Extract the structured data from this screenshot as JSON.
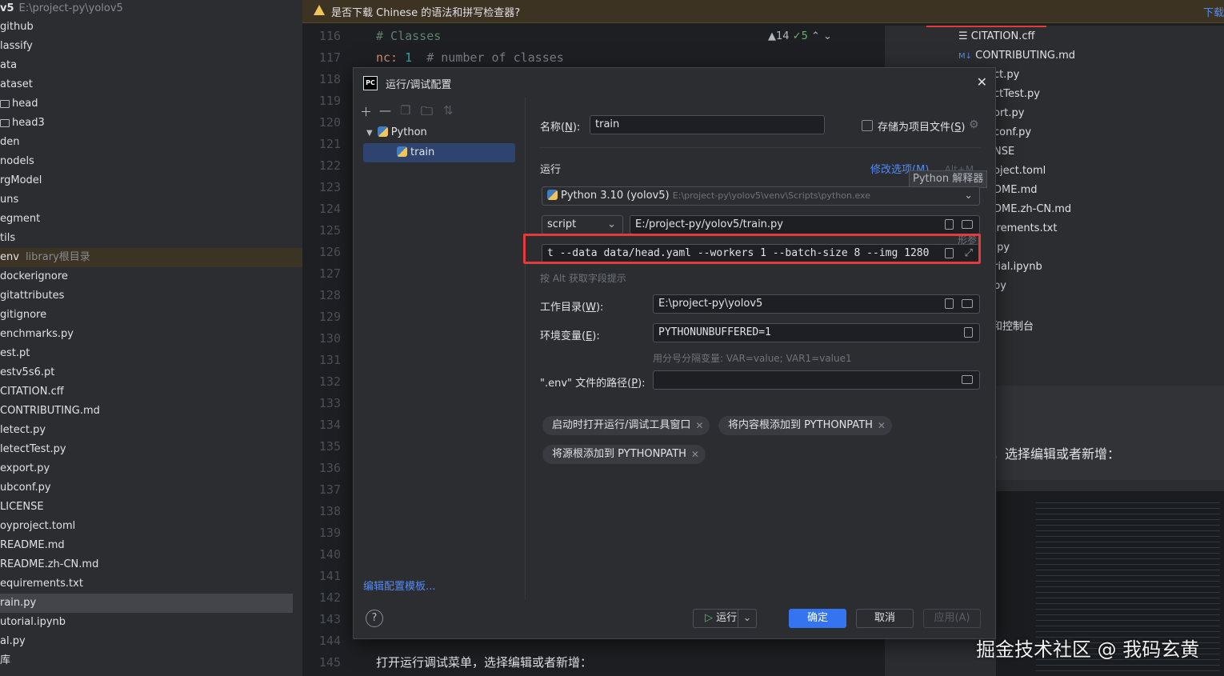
{
  "tree": {
    "header_name": "v5",
    "header_path": "E:\\project-py\\yolov5",
    "items": [
      "github",
      "lassify",
      "ata",
      "ataset",
      "head",
      "head3",
      "den",
      "nodels",
      "rgModel",
      "uns",
      "egment",
      "tils",
      "env",
      "dockerignore",
      "gitattributes",
      "gitignore",
      "enchmarks.py",
      "est.pt",
      "estv5s6.pt",
      "CITATION.cff",
      "CONTRIBUTING.md",
      "letect.py",
      "letectTest.py",
      "export.py",
      "ubconf.py",
      "LICENSE",
      "oyproject.toml",
      "README.md",
      "README.zh-CN.md",
      "equirements.txt",
      "rain.py",
      "utorial.ipynb",
      "al.py",
      "库"
    ],
    "venv_lib": "library根目录"
  },
  "notification": {
    "text": "是否下载 Chinese 的语法和拼写检查器?",
    "download": "下载"
  },
  "gutter": {
    "lines": [
      "116",
      "117",
      "118",
      "119",
      "120",
      "121",
      "122",
      "123",
      "124",
      "125",
      "126",
      "127",
      "128",
      "129",
      "130",
      "131",
      "132",
      "133",
      "134",
      "135",
      "136",
      "137",
      "138",
      "139",
      "140",
      "141",
      "142",
      "143",
      "144",
      "145"
    ]
  },
  "editor": {
    "line1": "# Classes",
    "line2_key": "nc:",
    "line2_val": "1",
    "line2_comment": "# number of classes",
    "warn_count": "▲14",
    "check_count": "✓5",
    "bottom_text": "打开运行调试菜单，选择编辑或者新增："
  },
  "right_panel": {
    "items": [
      "CITATION.cff",
      "CONTRIBUTING.md",
      "ct.py",
      "ctTest.py",
      "ort.py",
      "conf.py",
      "NSE",
      "oject.toml",
      "DME.md",
      "DME.zh-CN.md",
      "irements.txt",
      ".py",
      "rial.ipynb",
      "py"
    ],
    "console": "和控制台",
    "md_badge": "M↓",
    "article_text": "，选择编辑或者新增："
  },
  "dialog": {
    "title": "运行/调试配置",
    "pc_logo": "PC",
    "tree_python": "Python",
    "tree_train": "train",
    "edit_templates": "编辑配置模板...",
    "name_label": "名称(",
    "name_mn": "N",
    "name_label_end": "):",
    "name_value": "train",
    "store_label": "存储为项目文件(",
    "store_mn": "S",
    "store_label_end": ")",
    "run_section": "运行",
    "modify_options": "修改选项(M)",
    "modify_shortcut": "Alt+M",
    "interpreter_tooltip": "Python 解释器",
    "interpreter_name": "Python 3.10 (yolov5)",
    "interpreter_path": "E:\\project-py\\yolov5\\venv\\Scripts\\python.exe",
    "script_type": "script",
    "script_path": "E:/project-py/yolov5/train.py",
    "params_hint": "形参",
    "params_value": "t --data data/head.yaml --workers 1 --batch-size 8 --img 1280",
    "alt_hint": "按 Alt 获取字段提示",
    "workdir_label": "工作目录(",
    "workdir_mn": "W",
    "workdir_label_end": "):",
    "workdir_value": "E:\\project-py\\yolov5",
    "env_label": "环境变量(",
    "env_mn": "E",
    "env_label_end": "):",
    "env_value": "PYTHONUNBUFFERED=1",
    "env_hint": "用分号分隔变量: VAR=value; VAR1=value1",
    "dotenv_label": "\".env\" 文件的路径(",
    "dotenv_mn": "P",
    "dotenv_label_end": "):",
    "chips": [
      "启动时打开运行/调试工具窗口",
      "将内容根添加到 PYTHONPATH",
      "将源根添加到 PYTHONPATH"
    ],
    "btn_run": "运行",
    "btn_ok": "确定",
    "btn_cancel": "取消",
    "btn_apply": "应用(A)",
    "help": "?"
  },
  "watermark": "掘金技术社区 @ 我码玄黄",
  "colors": {
    "accent": "#3574f0",
    "highlight": "#e53a3a",
    "warning": "#f2c55c"
  }
}
